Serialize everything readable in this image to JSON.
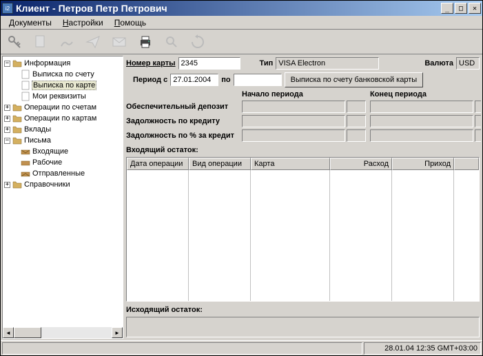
{
  "title": "Клиент - Петров Петр Петрович",
  "menu": {
    "documents": "Документы",
    "settings": "Настройки",
    "help": "Помощь"
  },
  "tree": {
    "info": "Информация",
    "acct_statement": "Выписка по счету",
    "card_statement": "Выписка по карте",
    "my_details": "Мои реквизиты",
    "acct_ops": "Операции по счетам",
    "card_ops": "Операции по картам",
    "deposits": "Вклады",
    "letters": "Письма",
    "inbox": "Входящие",
    "working": "Рабочие",
    "sent": "Отправленные",
    "refs": "Справочники"
  },
  "form": {
    "card_no_lbl": "Номер карты",
    "card_no": "2345",
    "type_lbl": "Тип",
    "type": "VISA Electron",
    "currency_lbl": "Валюта",
    "currency": "USD",
    "period_from_lbl": "Период с",
    "period_from": "27.01.2004",
    "to_lbl": "по",
    "period_to": "",
    "fetch_btn": "Выписка по счету банковской карты",
    "start_hdr": "Начало периода",
    "end_hdr": "Конец периода",
    "security_deposit": "Обеспечительный депозит",
    "credit_debt": "Задолжность по кредиту",
    "pct_debt": "Задолжность по % за кредит"
  },
  "table": {
    "incoming": "Входящий остаток:",
    "outgoing": "Исходящий остаток:",
    "cols": {
      "date": "Дата операции",
      "kind": "Вид операции",
      "card": "Карта",
      "debit": "Расход",
      "credit": "Приход"
    }
  },
  "status": {
    "time": "28.01.04 12:35 GMT+03:00"
  }
}
